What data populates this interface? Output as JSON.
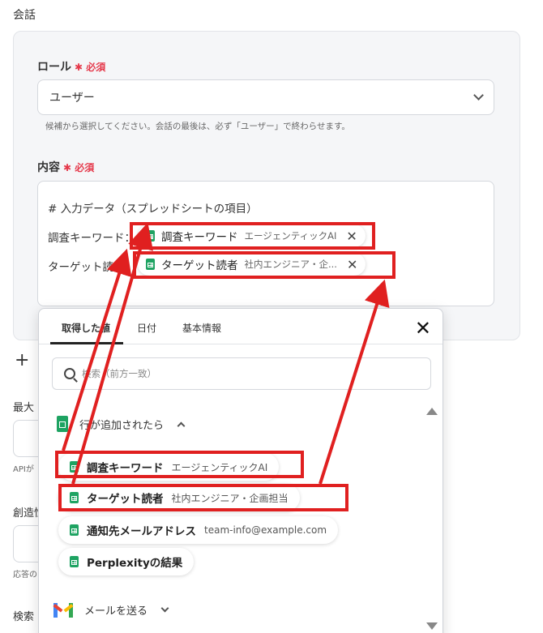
{
  "section_title": "会話",
  "role": {
    "label": "ロール",
    "required": "必須",
    "selected": "ユーザー",
    "hint": "候補から選択してください。会話の最後は、必ず「ユーザー」で終わらせます。"
  },
  "content": {
    "label": "内容",
    "required": "必須",
    "line1": "# 入力データ（スプレッドシートの項目）",
    "line2_label": "調査キーワード：",
    "line3_label": "ターゲット読者：",
    "chip1": {
      "name": "調査キーワード",
      "value": "エージェンティックAI"
    },
    "chip2": {
      "name": "ターゲット読者",
      "value": "社内エンジニア・企..."
    }
  },
  "background": {
    "max_label": "最大",
    "api_hint": "APIが",
    "creativity_label": "創造性",
    "response_hint": "応答の",
    "search_label": "検索"
  },
  "popup": {
    "tabs": [
      "取得した値",
      "日付",
      "基本情報"
    ],
    "search_placeholder": "検索（前方一致）",
    "group1": "行が追加されたら",
    "items": [
      {
        "name": "調査キーワード",
        "value": "エージェンティックAI"
      },
      {
        "name": "ターゲット読者",
        "value": "社内エンジニア・企画担当"
      },
      {
        "name": "通知先メールアドレス",
        "value": "team-info@example.com"
      },
      {
        "name": "Perplexityの結果",
        "value": ""
      }
    ],
    "group2": "メールを送る"
  },
  "colors": {
    "required": "#e5394b",
    "highlight": "#e02020",
    "sheets": "#1ea362"
  }
}
